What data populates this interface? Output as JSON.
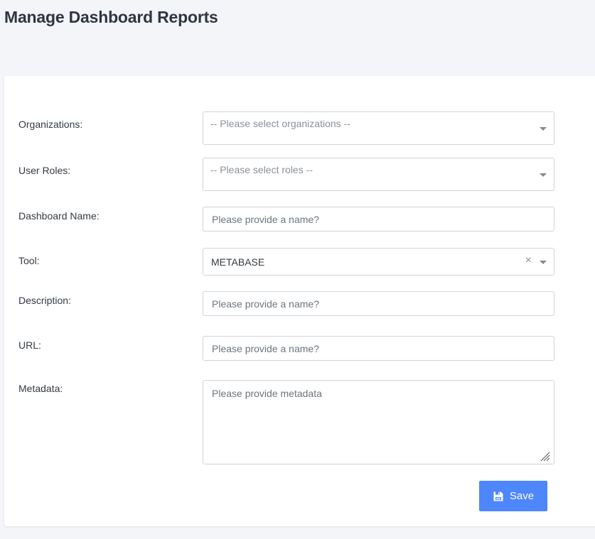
{
  "page": {
    "title": "Manage Dashboard Reports"
  },
  "form": {
    "organizations": {
      "label": "Organizations:",
      "placeholder": "-- Please select organizations --"
    },
    "user_roles": {
      "label": "User Roles:",
      "placeholder": "-- Please select roles --"
    },
    "dashboard_name": {
      "label": "Dashboard Name:",
      "placeholder": "Please provide a name?",
      "value": ""
    },
    "tool": {
      "label": "Tool:",
      "selected": "METABASE",
      "clear_symbol": "×"
    },
    "description": {
      "label": "Description:",
      "placeholder": "Please provide a name?",
      "value": ""
    },
    "url": {
      "label": "URL:",
      "placeholder": "Please provide a name?",
      "value": ""
    },
    "metadata": {
      "label": "Metadata:",
      "placeholder": "Please provide metadata",
      "value": ""
    },
    "save_label": "Save"
  },
  "colors": {
    "accent": "#4e86fb",
    "background": "#f4f5f8",
    "card": "#ffffff",
    "border": "#ced4da"
  },
  "icons": {
    "save": "floppy-disk-icon",
    "dropdown": "chevron-down-icon",
    "clear": "close-icon"
  }
}
